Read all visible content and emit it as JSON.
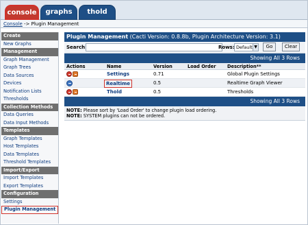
{
  "tabs": [
    {
      "label": "console"
    },
    {
      "label": "graphs"
    },
    {
      "label": "thold"
    }
  ],
  "breadcrumb": {
    "root": "Console",
    "separator": " -> ",
    "current": "Plugin Management"
  },
  "sidebar": {
    "items": [
      {
        "label": "Create",
        "type": "head"
      },
      {
        "label": "New Graphs",
        "type": "link"
      },
      {
        "label": "Management",
        "type": "head"
      },
      {
        "label": "Graph Management",
        "type": "link"
      },
      {
        "label": "Graph Trees",
        "type": "link"
      },
      {
        "label": "Data Sources",
        "type": "link"
      },
      {
        "label": "Devices",
        "type": "link"
      },
      {
        "label": "Notification Lists",
        "type": "link"
      },
      {
        "label": "Thresholds",
        "type": "link"
      },
      {
        "label": "Collection Methods",
        "type": "head"
      },
      {
        "label": "Data Queries",
        "type": "link"
      },
      {
        "label": "Data Input Methods",
        "type": "link"
      },
      {
        "label": "Templates",
        "type": "head"
      },
      {
        "label": "Graph Templates",
        "type": "link"
      },
      {
        "label": "Host Templates",
        "type": "link"
      },
      {
        "label": "Data Templates",
        "type": "link"
      },
      {
        "label": "Threshold Templates",
        "type": "link"
      },
      {
        "label": "Import/Export",
        "type": "head"
      },
      {
        "label": "Import Templates",
        "type": "link"
      },
      {
        "label": "Export Templates",
        "type": "link"
      },
      {
        "label": "Configuration",
        "type": "head"
      },
      {
        "label": "Settings",
        "type": "link"
      },
      {
        "label": "Plugin Management",
        "type": "selected"
      }
    ]
  },
  "panel": {
    "title": "Plugin Management",
    "subtitle": " (Cacti Version: 0.8.8b, Plugin Architecture Version: 3.1)",
    "search_label": "Search:",
    "search_value": "",
    "rows_label": "Rows:",
    "rows_value": "Default",
    "go_label": "Go",
    "clear_label": "Clear",
    "showing": "Showing All 3 Rows"
  },
  "table": {
    "headers": {
      "actions": "Actions",
      "name": "Name",
      "version": "Version",
      "load_order": "Load Order",
      "description": "Description**"
    },
    "rows": [
      {
        "name": "Settings",
        "version": "0.71",
        "load_order": "",
        "description": "Global Plugin Settings",
        "actions": [
          "uninstall-icon",
          "disable-icon"
        ]
      },
      {
        "name": "Realtime",
        "version": "0.5",
        "load_order": "",
        "description": "Realtime Graph Viewer",
        "actions": [
          "install-icon"
        ]
      },
      {
        "name": "Thold",
        "version": "0.5",
        "load_order": "",
        "description": "Thresholds",
        "actions": [
          "uninstall-icon",
          "disable-icon"
        ]
      }
    ]
  },
  "notes": {
    "line1_label": "NOTE:",
    "line1_text": " Please sort by 'Load Order' to change plugin load ordering.",
    "line2_label": "NOTE:",
    "line2_text": " SYSTEM plugins can not be ordered."
  }
}
